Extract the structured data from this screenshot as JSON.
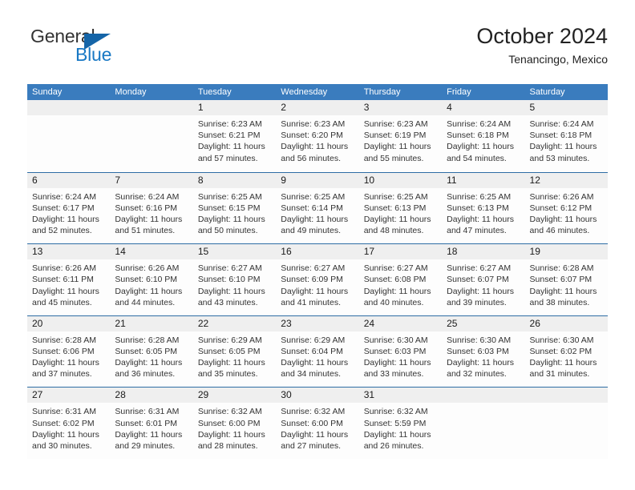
{
  "brand": {
    "word1": "General",
    "word2": "Blue",
    "triangle_icon": "triangle-icon",
    "accent_color": "#1878c4"
  },
  "header": {
    "title": "October 2024",
    "subtitle": "Tenancingo, Mexico"
  },
  "calendar": {
    "header_color": "#3a7cbe",
    "row_divider_color": "#2e6da4",
    "day_band_color": "#efefef",
    "weekdays": [
      "Sunday",
      "Monday",
      "Tuesday",
      "Wednesday",
      "Thursday",
      "Friday",
      "Saturday"
    ],
    "weeks": [
      [
        {
          "day": "",
          "lines": []
        },
        {
          "day": "",
          "lines": []
        },
        {
          "day": "1",
          "lines": [
            "Sunrise: 6:23 AM",
            "Sunset: 6:21 PM",
            "Daylight: 11 hours",
            "and 57 minutes."
          ]
        },
        {
          "day": "2",
          "lines": [
            "Sunrise: 6:23 AM",
            "Sunset: 6:20 PM",
            "Daylight: 11 hours",
            "and 56 minutes."
          ]
        },
        {
          "day": "3",
          "lines": [
            "Sunrise: 6:23 AM",
            "Sunset: 6:19 PM",
            "Daylight: 11 hours",
            "and 55 minutes."
          ]
        },
        {
          "day": "4",
          "lines": [
            "Sunrise: 6:24 AM",
            "Sunset: 6:18 PM",
            "Daylight: 11 hours",
            "and 54 minutes."
          ]
        },
        {
          "day": "5",
          "lines": [
            "Sunrise: 6:24 AM",
            "Sunset: 6:18 PM",
            "Daylight: 11 hours",
            "and 53 minutes."
          ]
        }
      ],
      [
        {
          "day": "6",
          "lines": [
            "Sunrise: 6:24 AM",
            "Sunset: 6:17 PM",
            "Daylight: 11 hours",
            "and 52 minutes."
          ]
        },
        {
          "day": "7",
          "lines": [
            "Sunrise: 6:24 AM",
            "Sunset: 6:16 PM",
            "Daylight: 11 hours",
            "and 51 minutes."
          ]
        },
        {
          "day": "8",
          "lines": [
            "Sunrise: 6:25 AM",
            "Sunset: 6:15 PM",
            "Daylight: 11 hours",
            "and 50 minutes."
          ]
        },
        {
          "day": "9",
          "lines": [
            "Sunrise: 6:25 AM",
            "Sunset: 6:14 PM",
            "Daylight: 11 hours",
            "and 49 minutes."
          ]
        },
        {
          "day": "10",
          "lines": [
            "Sunrise: 6:25 AM",
            "Sunset: 6:13 PM",
            "Daylight: 11 hours",
            "and 48 minutes."
          ]
        },
        {
          "day": "11",
          "lines": [
            "Sunrise: 6:25 AM",
            "Sunset: 6:13 PM",
            "Daylight: 11 hours",
            "and 47 minutes."
          ]
        },
        {
          "day": "12",
          "lines": [
            "Sunrise: 6:26 AM",
            "Sunset: 6:12 PM",
            "Daylight: 11 hours",
            "and 46 minutes."
          ]
        }
      ],
      [
        {
          "day": "13",
          "lines": [
            "Sunrise: 6:26 AM",
            "Sunset: 6:11 PM",
            "Daylight: 11 hours",
            "and 45 minutes."
          ]
        },
        {
          "day": "14",
          "lines": [
            "Sunrise: 6:26 AM",
            "Sunset: 6:10 PM",
            "Daylight: 11 hours",
            "and 44 minutes."
          ]
        },
        {
          "day": "15",
          "lines": [
            "Sunrise: 6:27 AM",
            "Sunset: 6:10 PM",
            "Daylight: 11 hours",
            "and 43 minutes."
          ]
        },
        {
          "day": "16",
          "lines": [
            "Sunrise: 6:27 AM",
            "Sunset: 6:09 PM",
            "Daylight: 11 hours",
            "and 41 minutes."
          ]
        },
        {
          "day": "17",
          "lines": [
            "Sunrise: 6:27 AM",
            "Sunset: 6:08 PM",
            "Daylight: 11 hours",
            "and 40 minutes."
          ]
        },
        {
          "day": "18",
          "lines": [
            "Sunrise: 6:27 AM",
            "Sunset: 6:07 PM",
            "Daylight: 11 hours",
            "and 39 minutes."
          ]
        },
        {
          "day": "19",
          "lines": [
            "Sunrise: 6:28 AM",
            "Sunset: 6:07 PM",
            "Daylight: 11 hours",
            "and 38 minutes."
          ]
        }
      ],
      [
        {
          "day": "20",
          "lines": [
            "Sunrise: 6:28 AM",
            "Sunset: 6:06 PM",
            "Daylight: 11 hours",
            "and 37 minutes."
          ]
        },
        {
          "day": "21",
          "lines": [
            "Sunrise: 6:28 AM",
            "Sunset: 6:05 PM",
            "Daylight: 11 hours",
            "and 36 minutes."
          ]
        },
        {
          "day": "22",
          "lines": [
            "Sunrise: 6:29 AM",
            "Sunset: 6:05 PM",
            "Daylight: 11 hours",
            "and 35 minutes."
          ]
        },
        {
          "day": "23",
          "lines": [
            "Sunrise: 6:29 AM",
            "Sunset: 6:04 PM",
            "Daylight: 11 hours",
            "and 34 minutes."
          ]
        },
        {
          "day": "24",
          "lines": [
            "Sunrise: 6:30 AM",
            "Sunset: 6:03 PM",
            "Daylight: 11 hours",
            "and 33 minutes."
          ]
        },
        {
          "day": "25",
          "lines": [
            "Sunrise: 6:30 AM",
            "Sunset: 6:03 PM",
            "Daylight: 11 hours",
            "and 32 minutes."
          ]
        },
        {
          "day": "26",
          "lines": [
            "Sunrise: 6:30 AM",
            "Sunset: 6:02 PM",
            "Daylight: 11 hours",
            "and 31 minutes."
          ]
        }
      ],
      [
        {
          "day": "27",
          "lines": [
            "Sunrise: 6:31 AM",
            "Sunset: 6:02 PM",
            "Daylight: 11 hours",
            "and 30 minutes."
          ]
        },
        {
          "day": "28",
          "lines": [
            "Sunrise: 6:31 AM",
            "Sunset: 6:01 PM",
            "Daylight: 11 hours",
            "and 29 minutes."
          ]
        },
        {
          "day": "29",
          "lines": [
            "Sunrise: 6:32 AM",
            "Sunset: 6:00 PM",
            "Daylight: 11 hours",
            "and 28 minutes."
          ]
        },
        {
          "day": "30",
          "lines": [
            "Sunrise: 6:32 AM",
            "Sunset: 6:00 PM",
            "Daylight: 11 hours",
            "and 27 minutes."
          ]
        },
        {
          "day": "31",
          "lines": [
            "Sunrise: 6:32 AM",
            "Sunset: 5:59 PM",
            "Daylight: 11 hours",
            "and 26 minutes."
          ]
        },
        {
          "day": "",
          "lines": []
        },
        {
          "day": "",
          "lines": []
        }
      ]
    ]
  }
}
